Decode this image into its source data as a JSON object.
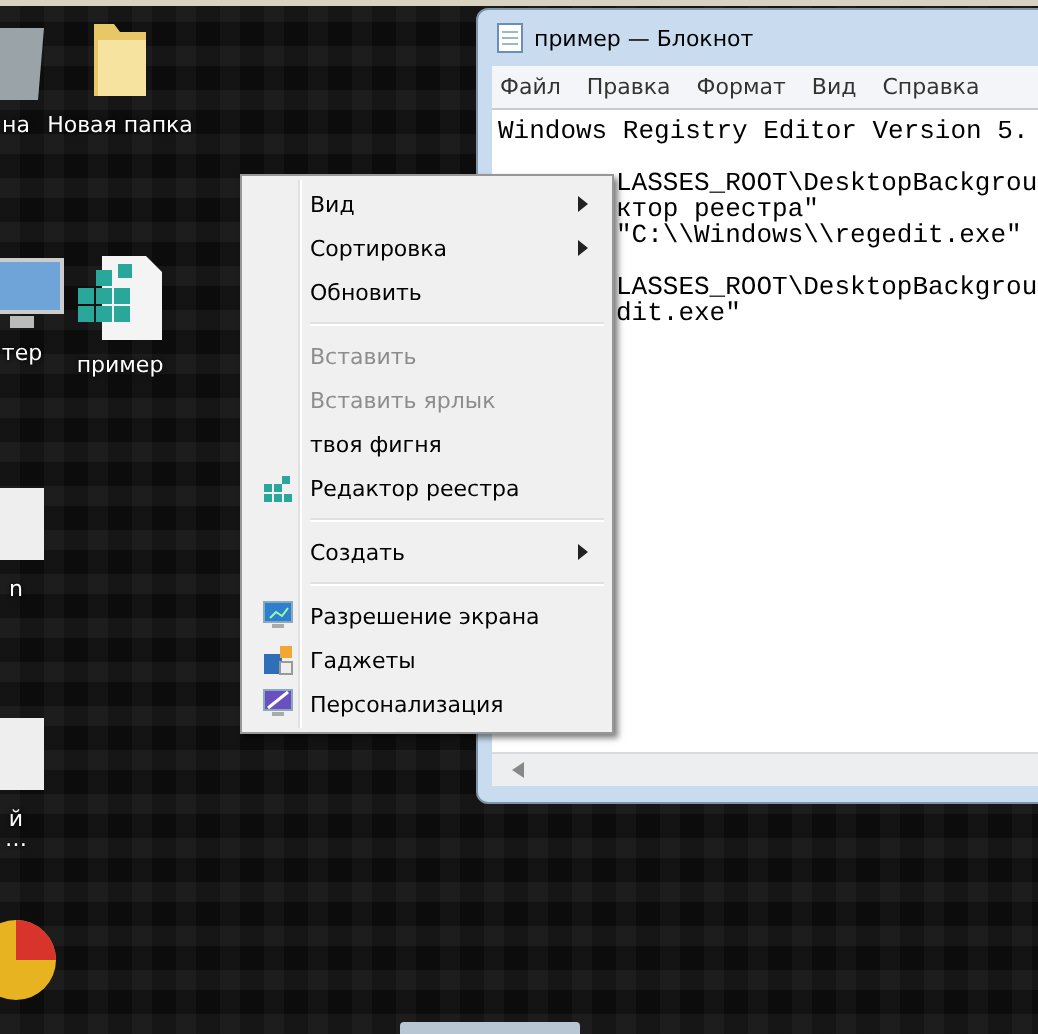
{
  "desktop_icons": [
    {
      "label": "на",
      "kind": "bin"
    },
    {
      "label": "Новая папка",
      "kind": "folder"
    },
    {
      "label": "тер",
      "kind": "computer"
    },
    {
      "label": "пример",
      "kind": "regfile"
    },
    {
      "label": "n",
      "kind": "file"
    },
    {
      "label": "й",
      "kind": "file"
    },
    {
      "label": "…",
      "kind": "caption"
    },
    {
      "kind": "ball"
    }
  ],
  "notepad": {
    "title": "пример — Блокнот",
    "menu": [
      "Файл",
      "Правка",
      "Формат",
      "Вид",
      "Справка"
    ],
    "lines": [
      {
        "kind": "text",
        "text": "Windows Registry Editor Version 5.",
        "covered": false
      },
      {
        "kind": "blank"
      },
      {
        "kind": "text",
        "text": "LASSES_ROOT\\DesktopBackgrou",
        "covered": true
      },
      {
        "kind": "text",
        "text": "ктор реестра\"",
        "covered": true
      },
      {
        "kind": "text",
        "text": "\"C:\\\\Windows\\\\regedit.exe\"",
        "covered": true
      },
      {
        "kind": "blank"
      },
      {
        "kind": "text",
        "text": "LASSES_ROOT\\DesktopBackgrou",
        "covered": true
      },
      {
        "kind": "text",
        "text": "dit.exe\"",
        "covered": true
      }
    ]
  },
  "context_menu": [
    {
      "kind": "item",
      "label": "Вид",
      "submenu": true,
      "disabled": false,
      "icon": false
    },
    {
      "kind": "item",
      "label": "Сортировка",
      "submenu": true,
      "disabled": false,
      "icon": false
    },
    {
      "kind": "item",
      "label": "Обновить",
      "submenu": false,
      "disabled": false,
      "icon": false
    },
    {
      "kind": "separator"
    },
    {
      "kind": "item",
      "label": "Вставить",
      "submenu": false,
      "disabled": true,
      "icon": false
    },
    {
      "kind": "item",
      "label": "Вставить ярлык",
      "submenu": false,
      "disabled": true,
      "icon": false
    },
    {
      "kind": "item",
      "label": "твоя фигня",
      "submenu": false,
      "disabled": false,
      "icon": false
    },
    {
      "kind": "item",
      "label": "Редактор реестра",
      "submenu": false,
      "disabled": false,
      "icon": true
    },
    {
      "kind": "separator"
    },
    {
      "kind": "item",
      "label": "Создать",
      "submenu": true,
      "disabled": false,
      "icon": false
    },
    {
      "kind": "separator"
    },
    {
      "kind": "item",
      "label": "Разрешение экрана",
      "submenu": false,
      "disabled": false,
      "icon": true
    },
    {
      "kind": "item",
      "label": "Гаджеты",
      "submenu": false,
      "disabled": false,
      "icon": true
    },
    {
      "kind": "item",
      "label": "Персонализация",
      "submenu": false,
      "disabled": false,
      "icon": true
    }
  ]
}
